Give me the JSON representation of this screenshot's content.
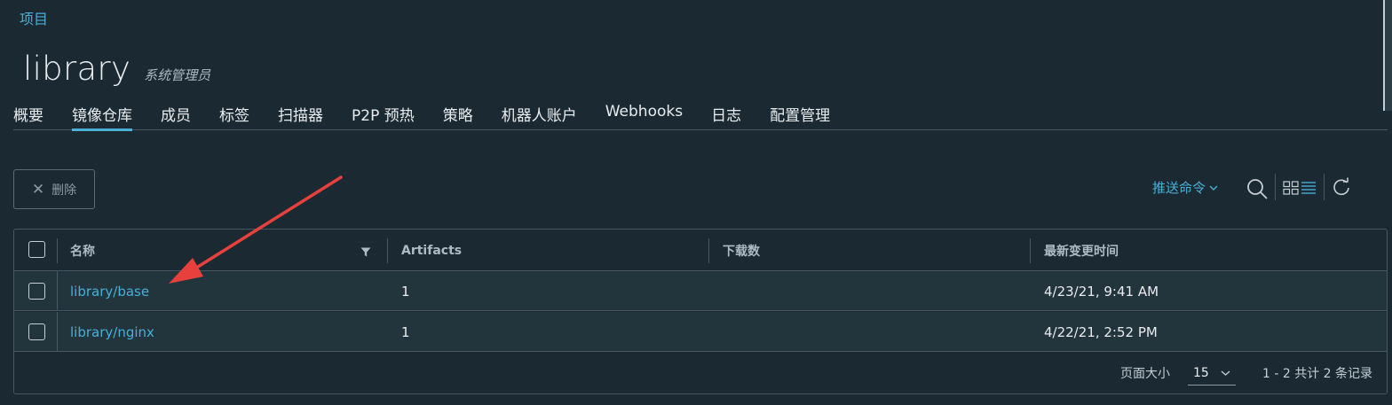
{
  "breadcrumb": "项目",
  "project": {
    "name": "library",
    "role": "系统管理员"
  },
  "tabs": [
    {
      "label": "概要",
      "active": false
    },
    {
      "label": "镜像仓库",
      "active": true
    },
    {
      "label": "成员",
      "active": false
    },
    {
      "label": "标签",
      "active": false
    },
    {
      "label": "扫描器",
      "active": false
    },
    {
      "label": "P2P 预热",
      "active": false
    },
    {
      "label": "策略",
      "active": false
    },
    {
      "label": "机器人账户",
      "active": false
    },
    {
      "label": "Webhooks",
      "active": false
    },
    {
      "label": "日志",
      "active": false
    },
    {
      "label": "配置管理",
      "active": false
    }
  ],
  "toolbar": {
    "delete_icon": "✕",
    "delete_label": "删除",
    "push_command": "推送命令",
    "icons": [
      "search-icon",
      "card-view-icon",
      "list-view-icon",
      "refresh-icon"
    ]
  },
  "grid": {
    "columns": [
      "名称",
      "Artifacts",
      "下载数",
      "最新变更时间"
    ],
    "rows": [
      {
        "name": "library/base",
        "artifacts": "1",
        "pulls": "",
        "updated": "4/23/21, 9:41 AM"
      },
      {
        "name": "library/nginx",
        "artifacts": "1",
        "pulls": "",
        "updated": "4/22/21, 2:52 PM"
      }
    ]
  },
  "pagination": {
    "page_size_label": "页面大小",
    "page_size": "15",
    "summary": "1 - 2 共计 2 条记录"
  },
  "colors": {
    "background": "#1b2a32",
    "accent": "#49afd9",
    "annotation_arrow": "#e8403c"
  }
}
